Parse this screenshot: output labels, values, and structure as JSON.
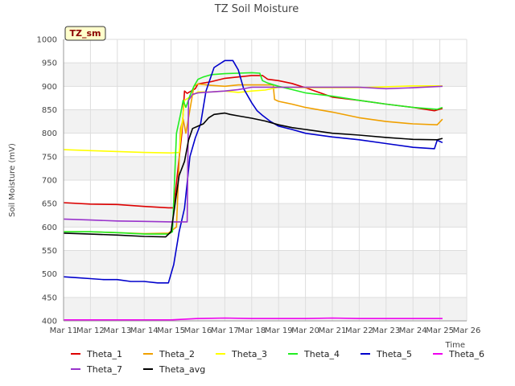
{
  "chart_data": {
    "type": "line",
    "title": "TZ Soil Moisture",
    "xlabel": "Time",
    "ylabel": "Soil Moisture (mV)",
    "tag": "TZ_sm",
    "x_tick_labels": [
      "Mar 11",
      "Mar 12",
      "Mar 13",
      "Mar 14",
      "Mar 15",
      "Mar 16",
      "Mar 17",
      "Mar 18",
      "Mar 19",
      "Mar 20",
      "Mar 21",
      "Mar 22",
      "Mar 23",
      "Mar 24",
      "Mar 25",
      "Mar 26"
    ],
    "xlim": [
      11,
      26
    ],
    "ylim": [
      400,
      1000
    ],
    "y_ticks": [
      400,
      450,
      500,
      550,
      600,
      650,
      700,
      750,
      800,
      850,
      900,
      950,
      1000
    ],
    "grid": true,
    "legend_position": "bottom",
    "colors": {
      "Theta_1": "#dd0000",
      "Theta_2": "#f0a000",
      "Theta_3": "#ffff00",
      "Theta_4": "#22ee22",
      "Theta_5": "#0000cc",
      "Theta_6": "#ee00ee",
      "Theta_7": "#9933cc",
      "Theta_avg": "#000000"
    },
    "series": [
      {
        "name": "Theta_1",
        "x": [
          11.0,
          12.0,
          13.0,
          14.0,
          14.9,
          15.1,
          15.4,
          15.5,
          15.6,
          15.9,
          16.0,
          16.5,
          17.0,
          17.5,
          18.0,
          18.4,
          18.6,
          19.0,
          19.5,
          20.0,
          20.5,
          21.0,
          22.0,
          23.0,
          24.0,
          24.8,
          25.1
        ],
        "y": [
          652,
          649,
          648,
          644,
          641,
          641,
          800,
          890,
          885,
          895,
          905,
          910,
          917,
          920,
          923,
          923,
          915,
          912,
          906,
          897,
          887,
          877,
          870,
          862,
          855,
          848,
          853
        ]
      },
      {
        "name": "Theta_2",
        "x": [
          11.0,
          12.0,
          13.0,
          14.0,
          14.9,
          15.2,
          15.35,
          15.45,
          15.55,
          15.7,
          15.85,
          16.0,
          16.5,
          17.0,
          17.5,
          18.0,
          18.8,
          18.85,
          19.0,
          19.5,
          20.0,
          21.0,
          22.0,
          23.0,
          24.0,
          24.9,
          25.1
        ],
        "y": [
          590,
          590,
          588,
          586,
          587,
          600,
          810,
          830,
          800,
          850,
          900,
          905,
          902,
          900,
          903,
          903,
          903,
          872,
          868,
          862,
          855,
          845,
          833,
          825,
          820,
          818,
          830
        ]
      },
      {
        "name": "Theta_3",
        "x": [
          11.0,
          12.0,
          13.0,
          14.0,
          15.0,
          15.3,
          15.5,
          16.0,
          16.5,
          17.0,
          17.5,
          18.0,
          18.5,
          19.0,
          20.0,
          21.0,
          22.0,
          23.0,
          24.0,
          25.1
        ],
        "y": [
          765,
          763,
          761,
          759,
          758,
          759,
          870,
          888,
          888,
          890,
          887,
          890,
          892,
          898,
          897,
          897,
          897,
          899,
          901,
          901
        ]
      },
      {
        "name": "Theta_4",
        "x": [
          11.0,
          12.0,
          13.0,
          14.0,
          14.9,
          15.05,
          15.2,
          15.35,
          15.45,
          15.55,
          15.7,
          15.85,
          16.0,
          16.2,
          16.5,
          17.0,
          17.5,
          18.0,
          18.3,
          18.4,
          18.6,
          19.0,
          19.5,
          20.0,
          21.0,
          22.0,
          23.0,
          24.0,
          24.9,
          25.1
        ],
        "y": [
          590,
          590,
          588,
          585,
          585,
          590,
          800,
          840,
          870,
          855,
          880,
          900,
          915,
          920,
          925,
          927,
          928,
          929,
          928,
          912,
          907,
          900,
          893,
          886,
          879,
          870,
          862,
          855,
          851,
          855
        ]
      },
      {
        "name": "Theta_5",
        "x": [
          11.0,
          11.5,
          12.0,
          12.5,
          13.0,
          13.5,
          14.0,
          14.5,
          14.9,
          15.1,
          15.3,
          15.5,
          15.7,
          15.9,
          16.1,
          16.3,
          16.6,
          17.0,
          17.3,
          17.5,
          17.7,
          18.0,
          18.2,
          18.4,
          18.7,
          19.0,
          19.5,
          20.0,
          21.0,
          22.0,
          23.0,
          24.0,
          24.8,
          24.9,
          25.1
        ],
        "y": [
          494,
          492,
          490,
          488,
          488,
          484,
          484,
          481,
          481,
          520,
          590,
          640,
          750,
          790,
          820,
          890,
          940,
          955,
          955,
          935,
          895,
          865,
          848,
          838,
          825,
          815,
          808,
          800,
          792,
          786,
          778,
          770,
          767,
          785,
          780
        ]
      },
      {
        "name": "Theta_6",
        "x": [
          11.0,
          13.0,
          15.0,
          16.0,
          17.0,
          18.0,
          19.0,
          20.0,
          21.0,
          22.0,
          23.0,
          24.0,
          25.1
        ],
        "y": [
          402,
          402,
          402,
          405,
          406,
          405,
          405,
          405,
          406,
          405,
          405,
          405,
          405
        ]
      },
      {
        "name": "Theta_7",
        "x": [
          11.0,
          12.0,
          13.0,
          14.0,
          15.0,
          15.6,
          15.65,
          15.8,
          16.0,
          16.5,
          17.0,
          17.5,
          18.0,
          18.5,
          19.0,
          20.0,
          21.0,
          22.0,
          23.0,
          24.0,
          25.1
        ],
        "y": [
          617,
          615,
          613,
          612,
          611,
          611,
          870,
          883,
          886,
          888,
          890,
          893,
          898,
          898,
          898,
          898,
          898,
          898,
          895,
          897,
          900
        ]
      },
      {
        "name": "Theta_avg",
        "x": [
          11.0,
          12.0,
          13.0,
          14.0,
          14.8,
          15.0,
          15.3,
          15.5,
          15.65,
          15.8,
          16.0,
          16.2,
          16.4,
          16.6,
          17.0,
          17.2,
          17.5,
          18.0,
          18.5,
          19.0,
          19.5,
          20.0,
          21.0,
          22.0,
          23.0,
          24.0,
          24.9,
          25.1
        ],
        "y": [
          587,
          585,
          583,
          580,
          579,
          590,
          710,
          740,
          785,
          810,
          815,
          820,
          833,
          840,
          843,
          840,
          837,
          832,
          826,
          818,
          812,
          808,
          800,
          796,
          791,
          787,
          786,
          789
        ]
      }
    ]
  }
}
